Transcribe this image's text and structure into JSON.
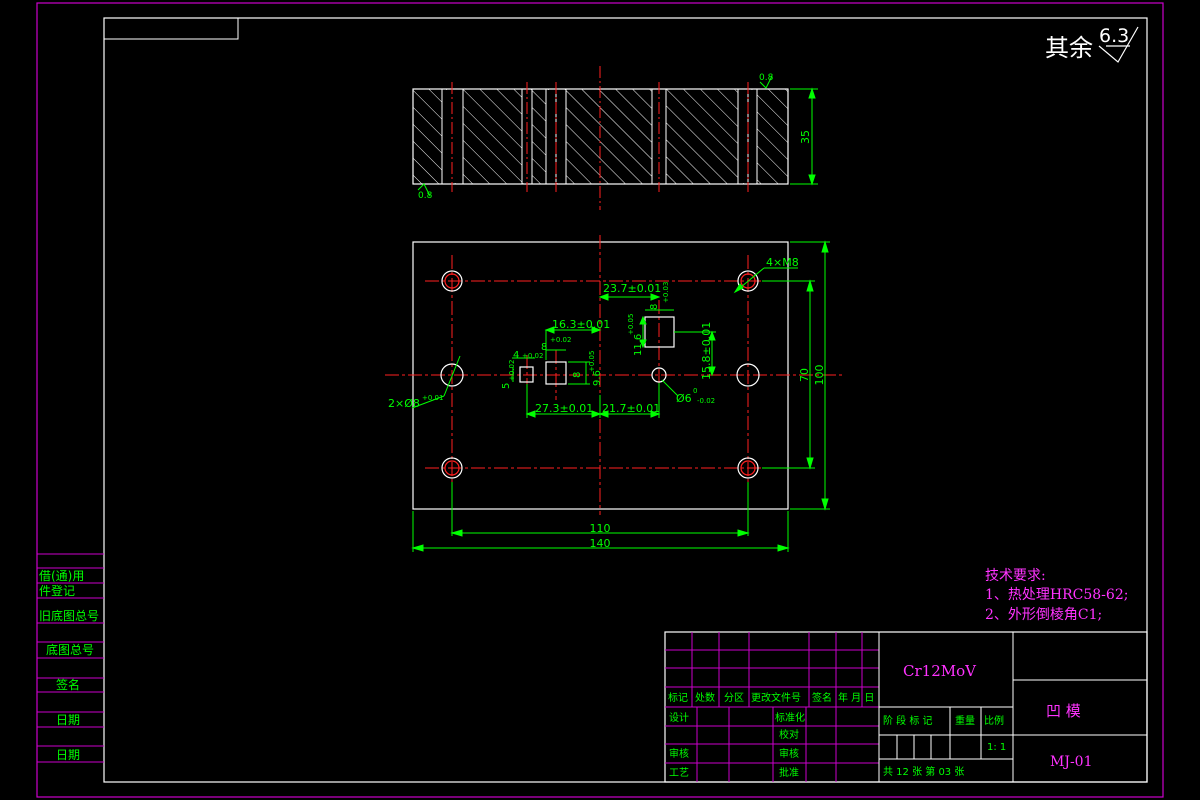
{
  "roughness": {
    "prefix": "其余",
    "value": "6.3"
  },
  "side_view": {
    "ra_top": "0.8",
    "ra_bottom": "0.8",
    "thickness_dim": "35"
  },
  "top_view": {
    "width_outer_dim": "140",
    "width_inner_dim": "110",
    "height_outer_dim": "100",
    "height_inner_dim": "70",
    "thread_note": "4×M8",
    "pin_note_main": "2×Ø8",
    "pin_note_tol": "+0.01",
    "hole6_main": "Ø6",
    "hole6_tol": "-0.02",
    "dim_23_7": "23.7±0.01",
    "dim_16_3": "16.3±0.01",
    "dim_15_8": "15.8±0.01",
    "dim_27_3": "27.3±0.01",
    "dim_21_7": "21.7±0.01",
    "dim_8a": "8",
    "dim_8a_tol": "+0.02",
    "dim_8b": "8",
    "dim_8b_tol": "+0.03",
    "dim_8c": "8",
    "dim_4": "4",
    "dim_4_tol": "+0.02",
    "dim_5": "5",
    "dim_5_tol": "+0.02",
    "dim_9_6": "9.6",
    "dim_9_6_tol": "+0.05",
    "dim_11_6": "11.6",
    "dim_11_6_tol": "+0.05",
    "zero": "0"
  },
  "tech_requirements": {
    "title": "技术要求:",
    "item1": "1、热处理HRC58-62;",
    "item2": "2、外形倒棱角C1;"
  },
  "left_column": {
    "l1": "借(通)用",
    "l2": "件登记",
    "l3": "旧底图总号",
    "l4": "底图总号",
    "l5": "签名",
    "l6": "日期",
    "l7": "日期"
  },
  "title_block": {
    "material": "Cr12MoV",
    "part_name": "凹  模",
    "drawing_no": "MJ-01",
    "hdr_mark": "标记",
    "hdr_count": "处数",
    "hdr_zone": "分区",
    "hdr_doc": "更改文件号",
    "hdr_sign": "签名",
    "hdr_date": "年 月 日",
    "design": "设计",
    "standardize": "标准化",
    "check": "校对",
    "review": "审核",
    "audit": "审核",
    "process": "工艺",
    "approve": "批准",
    "stage_mark": "阶 段 标 记",
    "weight": "重量",
    "scale": "比例",
    "scale_value": "1: 1",
    "sheets": "共 12 张   第 03 张"
  },
  "colors": {
    "frame": "#cc00cc",
    "geometry": "#ffffff",
    "dimension": "#00ff00",
    "centerline": "#ff2020",
    "tech_text": "#ff33ff"
  }
}
